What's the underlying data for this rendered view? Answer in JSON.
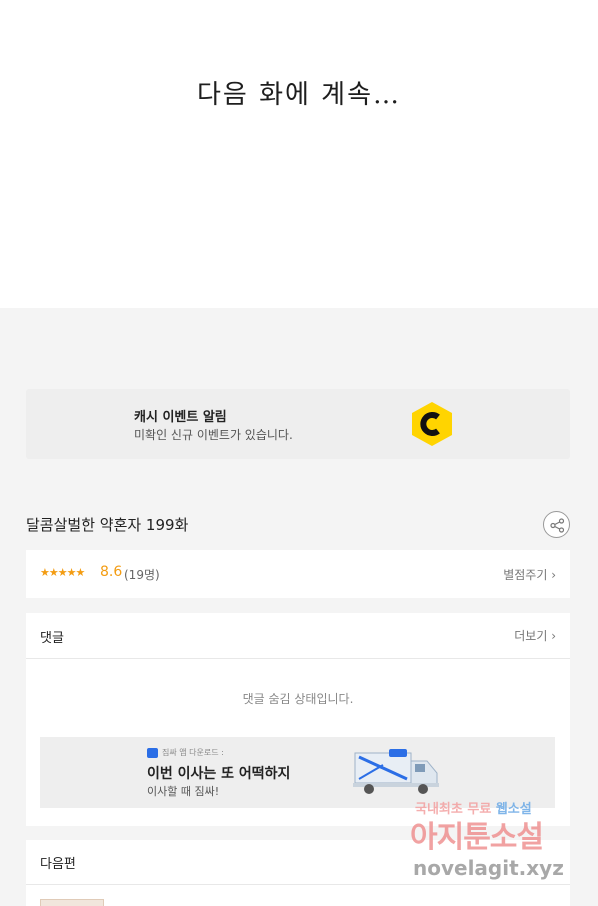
{
  "comic": {
    "end_text": "다음 화에 계속…"
  },
  "banner": {
    "title": "캐시 이벤트 알림",
    "subtitle": "미확인 신규 이벤트가 있습니다.",
    "icon": "cash-c-icon",
    "brand_color": "#ffd400"
  },
  "episode": {
    "title": "달콤살벌한 약혼자 199화"
  },
  "rating": {
    "stars": "★★★★★",
    "score": "8.6",
    "count": "(19명)",
    "rate_link": "별점주기 ›",
    "accent_color": "#f39c12"
  },
  "comments": {
    "heading": "댓글",
    "more_link": "더보기 ›",
    "hidden_message": "댓글 숨김 상태입니다."
  },
  "ad": {
    "app_text": "짐싸 앱 다운로드 :",
    "title": "이번 이사는 또 어떡하지",
    "subtitle": "이사할 때 짐싸!"
  },
  "next": {
    "heading": "다음편"
  },
  "watermark": {
    "line1_a": "국내최초 무료 ",
    "line1_b": "웹소설",
    "line2": "아지툰소설",
    "line3": "novelagit.xyz"
  }
}
